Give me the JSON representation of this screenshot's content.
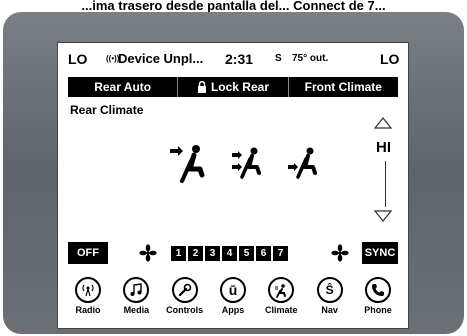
{
  "caption": "...ima trasero desde pantalla del... Connect de 7...",
  "status": {
    "temp_left": "LO",
    "device_text": "Device Unpl...",
    "time": "2:31",
    "compass": "S",
    "outside_temp": "75° out.",
    "temp_right": "LO"
  },
  "tabs": [
    {
      "label": "Rear Auto"
    },
    {
      "label": "Lock Rear"
    },
    {
      "label": "Front Climate"
    }
  ],
  "title": "Rear Climate",
  "temperature": {
    "value": "HI"
  },
  "controls": {
    "off_label": "OFF",
    "sync_label": "SYNC",
    "fan_levels": [
      "1",
      "2",
      "3",
      "4",
      "5",
      "6",
      "7"
    ]
  },
  "dock": [
    {
      "label": "Radio",
      "icon": "radio-icon"
    },
    {
      "label": "Media",
      "icon": "media-icon"
    },
    {
      "label": "Controls",
      "icon": "controls-icon"
    },
    {
      "label": "Apps",
      "icon": "apps-icon"
    },
    {
      "label": "Climate",
      "icon": "climate-icon"
    },
    {
      "label": "Nav",
      "icon": "nav-icon"
    },
    {
      "label": "Phone",
      "icon": "phone-icon"
    }
  ]
}
